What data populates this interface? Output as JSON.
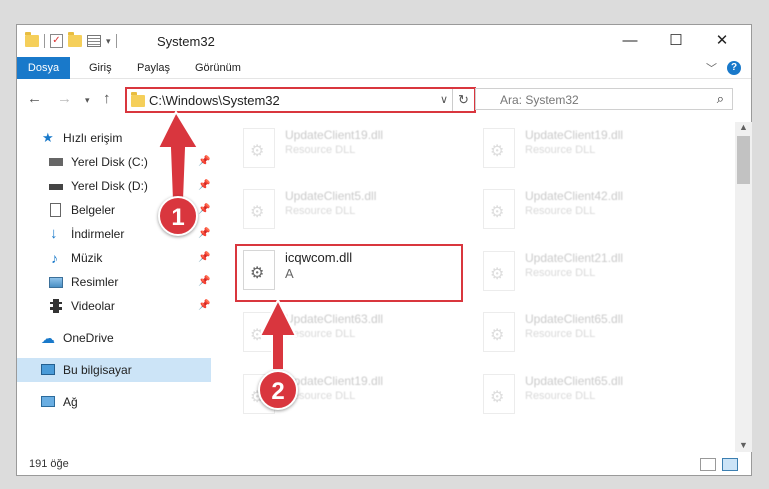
{
  "window": {
    "title": "System32",
    "controls": {
      "minimize": "—",
      "maximize": "☐",
      "close": "✕"
    }
  },
  "ribbon": {
    "tabs": [
      "Dosya",
      "Giriş",
      "Paylaş",
      "Görünüm"
    ],
    "help": "?"
  },
  "nav": {
    "address": "C:\\Windows\\System32",
    "search_placeholder": "Ara: System32"
  },
  "sidebar": {
    "quick_access": "Hızlı erişim",
    "items": [
      {
        "label": "Yerel Disk (C:)",
        "icon": "drive-icon",
        "pinned": true
      },
      {
        "label": "Yerel Disk (D:)",
        "icon": "drive-icon",
        "pinned": true
      },
      {
        "label": "Belgeler",
        "icon": "documents-icon",
        "pinned": true
      },
      {
        "label": "İndirmeler",
        "icon": "download-icon",
        "pinned": true
      },
      {
        "label": "Müzik",
        "icon": "music-icon",
        "pinned": true
      },
      {
        "label": "Resimler",
        "icon": "pictures-icon",
        "pinned": true
      },
      {
        "label": "Videolar",
        "icon": "videos-icon",
        "pinned": true
      }
    ],
    "onedrive": "OneDrive",
    "this_pc": "Bu bilgisayar",
    "network": "Ağ"
  },
  "files": [
    {
      "name": "UpdateClient19.dll",
      "type": "Resource DLL"
    },
    {
      "name": "UpdateClient19.dll",
      "type": "Resource DLL"
    },
    {
      "name": "UpdateClient5.dll",
      "type": "Resource DLL"
    },
    {
      "name": "UpdateClient42.dll",
      "type": "Resource DLL"
    },
    {
      "name": "icqwcom.dll",
      "type": "A"
    },
    {
      "name": "UpdateClient21.dll",
      "type": "Resource DLL"
    },
    {
      "name": "UpdateClient63.dll",
      "type": "Resource DLL"
    },
    {
      "name": "UpdateClient65.dll",
      "type": "Resource DLL"
    },
    {
      "name": "UpdateClient19.dll",
      "type": "Resource DLL"
    },
    {
      "name": "UpdateClient65.dll",
      "type": "Resource DLL"
    }
  ],
  "status": {
    "count": "191 öğe"
  },
  "annotations": {
    "step1": "1",
    "step2": "2"
  },
  "colors": {
    "accent": "#1979ca",
    "highlight": "#d9363e",
    "selection": "#cce4f7"
  }
}
